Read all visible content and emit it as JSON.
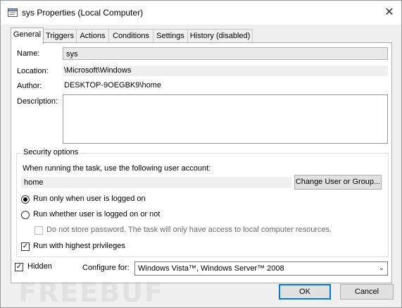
{
  "window": {
    "title": "sys Properties (Local Computer)"
  },
  "tabs": [
    {
      "label": "General",
      "active": true
    },
    {
      "label": "Triggers"
    },
    {
      "label": "Actions"
    },
    {
      "label": "Conditions"
    },
    {
      "label": "Settings"
    },
    {
      "label": "History (disabled)"
    }
  ],
  "general": {
    "name_label": "Name:",
    "name_value": "sys",
    "location_label": "Location:",
    "location_value": "\\Microsoft\\Windows",
    "author_label": "Author:",
    "author_value": "DESKTOP-9OEGBK9\\home",
    "description_label": "Description:",
    "description_value": ""
  },
  "security": {
    "group_title": "Security options",
    "account_prompt": "When running the task, use the following user account:",
    "account_value": "home",
    "change_button": "Change User or Group...",
    "run_logged_on": "Run only when user is logged on",
    "run_whether": "Run whether user is logged on or not",
    "no_store_password": "Do not store password.  The task will only have access to local computer resources.",
    "highest_privileges": "Run with highest privileges",
    "selected_run_option": "Run only when user is logged on",
    "highest_privileges_checked": true
  },
  "footer": {
    "hidden_label": "Hidden",
    "hidden_checked": true,
    "configure_label": "Configure for:",
    "configure_value": "Windows Vista™, Windows Server™ 2008",
    "ok_label": "OK",
    "cancel_label": "Cancel"
  },
  "watermark": "FREEBUF",
  "icons": {
    "title": "task-icon",
    "close": "close-icon",
    "dropdown": "chevron-down-icon",
    "check": "checkmark-icon"
  }
}
